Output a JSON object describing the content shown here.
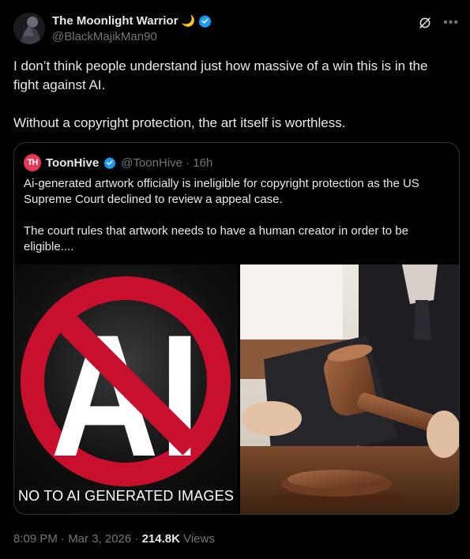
{
  "author": {
    "display_name": "The Moonlight Warrior",
    "emoji": "🌙",
    "handle": "@BlackMajikMan90",
    "icons": [
      "verified-badge-icon",
      "grok-icon",
      "more-icon"
    ]
  },
  "tweet": {
    "paragraphs": [
      "I don’t think people understand just how massive of a win this is in the fight against AI.",
      "Without a copyright protection, the art itself is worthless."
    ]
  },
  "quote": {
    "avatar_text": "TH",
    "name": "ToonHive",
    "handle": "@ToonHive · 16h",
    "paragraphs": [
      "Ai-generated artwork officially is ineligible for copyright protection as the US Supreme Court declined to review a appeal case.",
      "The court rules that artwork needs to have a human creator in order to be eligible...."
    ],
    "media": {
      "left_image_text": "AI",
      "left_image_caption": "NO TO AI GENERATED IMAGES",
      "right_image": "judge-gavel-photo"
    }
  },
  "footer": {
    "time": "8:09 PM · Mar 3, 2026 · ",
    "views_count": "214.8K",
    "views_label": " Views"
  },
  "colors": {
    "background": "#000000",
    "text": "#e7e9ea",
    "muted": "#71767b",
    "verified": "#1d9bf0",
    "border": "#2f3336",
    "prohibition_red": "#c8102e",
    "toonhive_brand": "#e8385a"
  }
}
